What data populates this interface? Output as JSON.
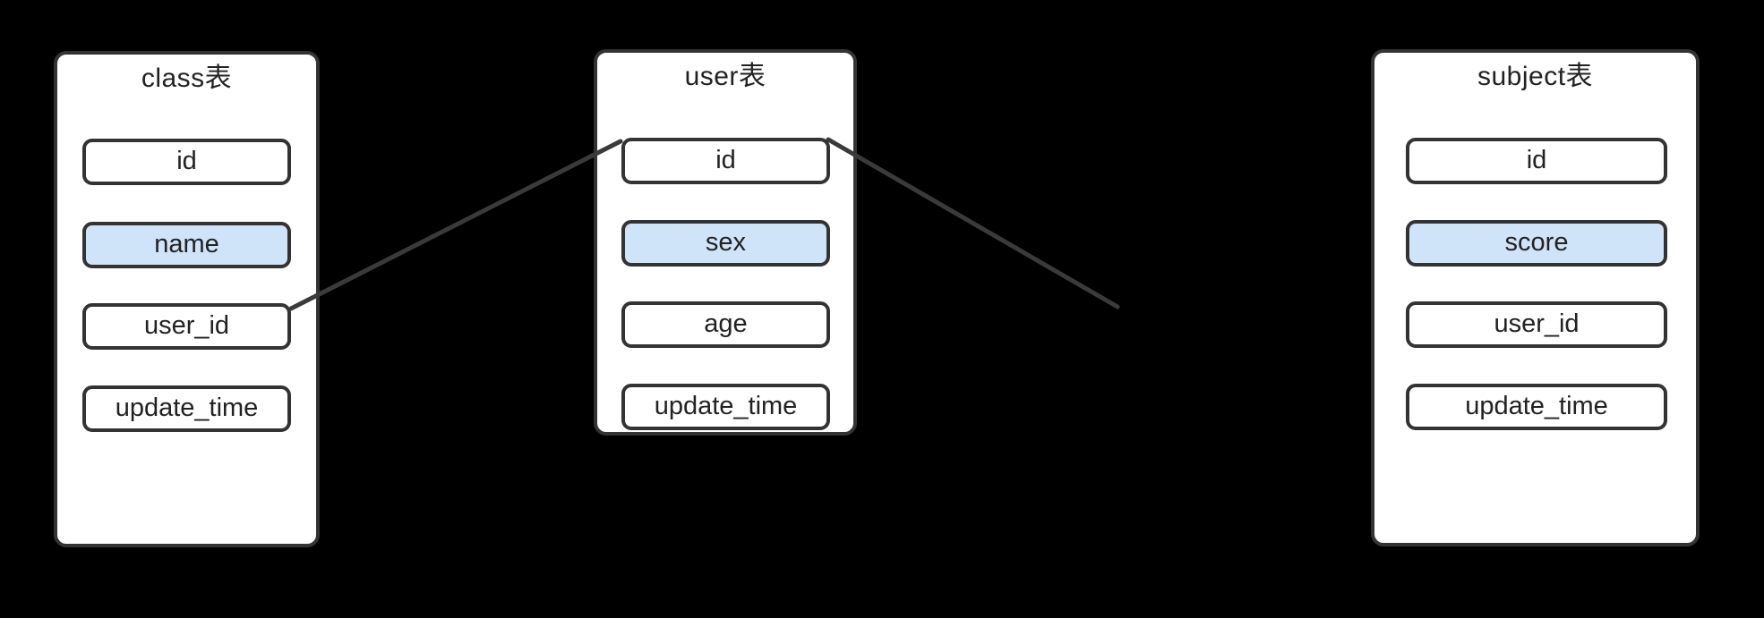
{
  "diagram": {
    "type": "entity-relationship-diagram",
    "background_color": "#000000",
    "card_background_color": "#ffffff",
    "border_color": "#333333",
    "highlight_color": "#cfe3f9",
    "text_color": "#222222",
    "connector_color": "#3a3a3a"
  },
  "tables": [
    {
      "id": "class",
      "title": "class表",
      "fields": [
        {
          "name": "id",
          "highlight": false
        },
        {
          "name": "name",
          "highlight": true
        },
        {
          "name": "user_id",
          "highlight": false
        },
        {
          "name": "update_time",
          "highlight": false
        }
      ]
    },
    {
      "id": "user",
      "title": "user表",
      "fields": [
        {
          "name": "id",
          "highlight": false
        },
        {
          "name": "sex",
          "highlight": true
        },
        {
          "name": "age",
          "highlight": false
        },
        {
          "name": "update_time",
          "highlight": false
        }
      ]
    },
    {
      "id": "subject",
      "title": "subject表",
      "fields": [
        {
          "name": "id",
          "highlight": false
        },
        {
          "name": "score",
          "highlight": true
        },
        {
          "name": "user_id",
          "highlight": false
        },
        {
          "name": "update_time",
          "highlight": false
        }
      ]
    }
  ],
  "relations": [
    {
      "id": "class-user",
      "from_table": "class",
      "from_field": "user_id",
      "to_table": "user",
      "to_field": "id"
    },
    {
      "id": "user-subject",
      "from_table": "user",
      "from_field": "id",
      "to_table": "subject",
      "to_field": "user_id"
    }
  ]
}
